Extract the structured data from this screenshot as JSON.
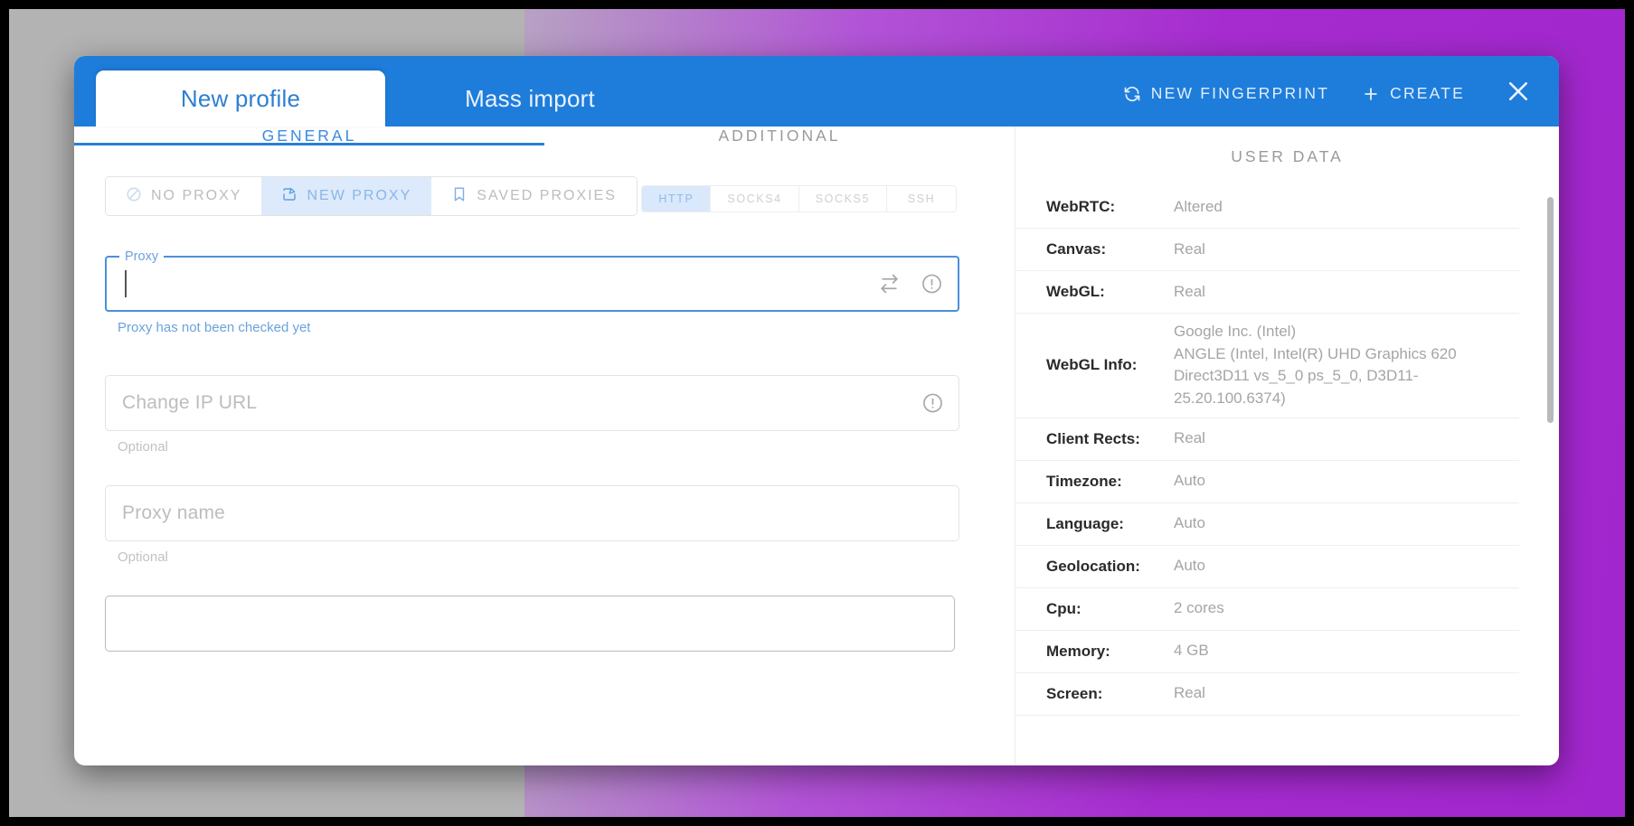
{
  "window": {
    "tabs": [
      {
        "label": "New profile",
        "active": true
      },
      {
        "label": "Mass import",
        "active": false
      }
    ],
    "actions": {
      "new_fingerprint": "NEW FINGERPRINT",
      "create": "CREATE"
    }
  },
  "section_tabs": [
    {
      "label": "GENERAL",
      "active": true
    },
    {
      "label": "ADDITIONAL",
      "active": false
    },
    {
      "label": "USER DATA",
      "active": false
    }
  ],
  "proxy": {
    "modes": [
      {
        "label": "NO PROXY",
        "icon": "no-entry-icon",
        "active": false
      },
      {
        "label": "NEW PROXY",
        "icon": "edit-square-icon",
        "active": true
      },
      {
        "label": "SAVED PROXIES",
        "icon": "bookmark-icon",
        "active": false
      }
    ],
    "protocols": [
      {
        "label": "HTTP",
        "active": true
      },
      {
        "label": "SOCKS4",
        "active": false
      },
      {
        "label": "SOCKS5",
        "active": false
      },
      {
        "label": "SSH",
        "active": false
      }
    ],
    "proxy_field": {
      "label": "Proxy",
      "value": "",
      "placeholder": "",
      "helper": "Proxy has not been checked yet",
      "icons": [
        "swap-arrows-icon",
        "info-circle-icon"
      ]
    },
    "change_ip_field": {
      "placeholder": "Change IP URL",
      "value": "",
      "helper": "Optional",
      "icons": [
        "info-circle-icon"
      ]
    },
    "proxy_name_field": {
      "placeholder": "Proxy name",
      "value": "",
      "helper": "Optional"
    },
    "extra_field": {
      "placeholder": "",
      "value": ""
    }
  },
  "user_data": {
    "title": "USER DATA",
    "rows": [
      {
        "key": "WebRTC:",
        "value": "Altered"
      },
      {
        "key": "Canvas:",
        "value": "Real"
      },
      {
        "key": "WebGL:",
        "value": "Real"
      },
      {
        "key": "WebGL Info:",
        "value": "Google Inc. (Intel)",
        "value2": "ANGLE (Intel, Intel(R) UHD Graphics 620 Direct3D11 vs_5_0 ps_5_0, D3D11-25.20.100.6374)"
      },
      {
        "key": "Client Rects:",
        "value": "Real"
      },
      {
        "key": "Timezone:",
        "value": "Auto"
      },
      {
        "key": "Language:",
        "value": "Auto"
      },
      {
        "key": "Geolocation:",
        "value": "Auto"
      },
      {
        "key": "Cpu:",
        "value": "2 cores"
      },
      {
        "key": "Memory:",
        "value": "4 GB"
      },
      {
        "key": "Screen:",
        "value": "Real"
      }
    ]
  },
  "colors": {
    "titlebar_blue": "#1e7ddb",
    "accent_blue": "#2a7fd4",
    "backdrop_purple": "#a228ce",
    "backdrop_gray": "#b3b3b3"
  }
}
